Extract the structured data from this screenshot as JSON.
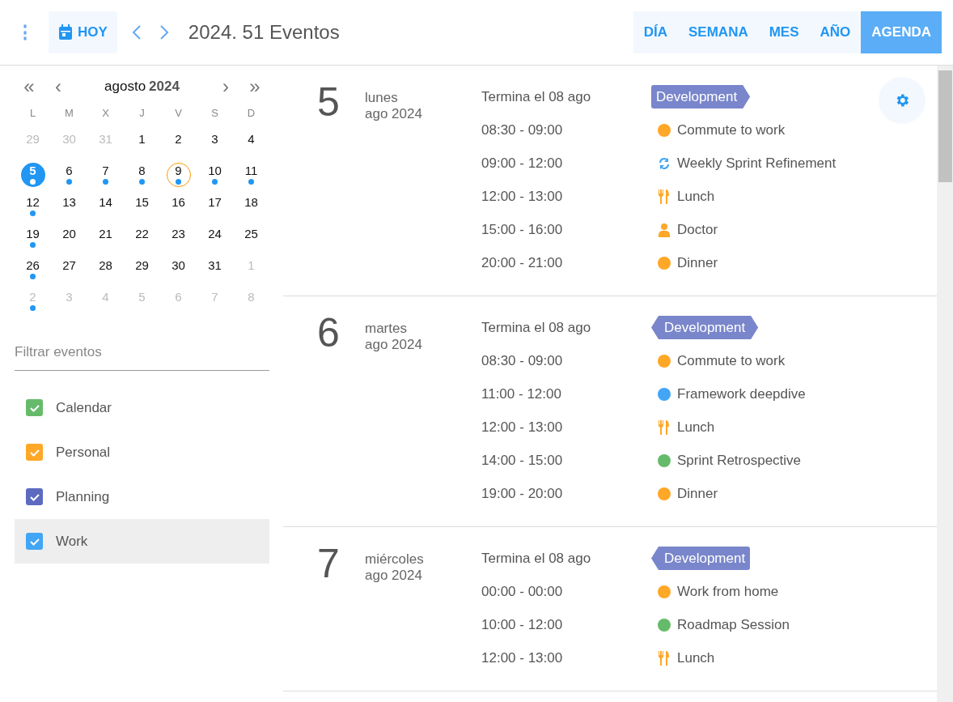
{
  "toolbar": {
    "menu_label": "⋮",
    "today_label": "HOY",
    "title": "2024. 51 Eventos",
    "views": [
      {
        "label": "DÍA",
        "selected": false
      },
      {
        "label": "SEMANA",
        "selected": false
      },
      {
        "label": "MES",
        "selected": false
      },
      {
        "label": "AÑO",
        "selected": false
      },
      {
        "label": "AGENDA",
        "selected": true
      }
    ]
  },
  "mini_calendar": {
    "prev_year": "«",
    "prev_month": "‹",
    "month": "agosto",
    "year": "2024",
    "next_month": "›",
    "next_year": "»",
    "weekdays": [
      "L",
      "M",
      "X",
      "J",
      "V",
      "S",
      "D"
    ],
    "days": [
      {
        "label": "29",
        "outside": true,
        "selected": false,
        "today": false,
        "has_events": false
      },
      {
        "label": "30",
        "outside": true,
        "selected": false,
        "today": false,
        "has_events": false
      },
      {
        "label": "31",
        "outside": true,
        "selected": false,
        "today": false,
        "has_events": false
      },
      {
        "label": "1",
        "outside": false,
        "selected": false,
        "today": false,
        "has_events": false
      },
      {
        "label": "2",
        "outside": false,
        "selected": false,
        "today": false,
        "has_events": false
      },
      {
        "label": "3",
        "outside": false,
        "selected": false,
        "today": false,
        "has_events": false
      },
      {
        "label": "4",
        "outside": false,
        "selected": false,
        "today": false,
        "has_events": false
      },
      {
        "label": "5",
        "outside": false,
        "selected": true,
        "today": false,
        "has_events": true
      },
      {
        "label": "6",
        "outside": false,
        "selected": false,
        "today": false,
        "has_events": true
      },
      {
        "label": "7",
        "outside": false,
        "selected": false,
        "today": false,
        "has_events": true
      },
      {
        "label": "8",
        "outside": false,
        "selected": false,
        "today": false,
        "has_events": true
      },
      {
        "label": "9",
        "outside": false,
        "selected": false,
        "today": true,
        "has_events": true
      },
      {
        "label": "10",
        "outside": false,
        "selected": false,
        "today": false,
        "has_events": true
      },
      {
        "label": "11",
        "outside": false,
        "selected": false,
        "today": false,
        "has_events": true
      },
      {
        "label": "12",
        "outside": false,
        "selected": false,
        "today": false,
        "has_events": true
      },
      {
        "label": "13",
        "outside": false,
        "selected": false,
        "today": false,
        "has_events": false
      },
      {
        "label": "14",
        "outside": false,
        "selected": false,
        "today": false,
        "has_events": false
      },
      {
        "label": "15",
        "outside": false,
        "selected": false,
        "today": false,
        "has_events": false
      },
      {
        "label": "16",
        "outside": false,
        "selected": false,
        "today": false,
        "has_events": false
      },
      {
        "label": "17",
        "outside": false,
        "selected": false,
        "today": false,
        "has_events": false
      },
      {
        "label": "18",
        "outside": false,
        "selected": false,
        "today": false,
        "has_events": false
      },
      {
        "label": "19",
        "outside": false,
        "selected": false,
        "today": false,
        "has_events": true
      },
      {
        "label": "20",
        "outside": false,
        "selected": false,
        "today": false,
        "has_events": false
      },
      {
        "label": "21",
        "outside": false,
        "selected": false,
        "today": false,
        "has_events": false
      },
      {
        "label": "22",
        "outside": false,
        "selected": false,
        "today": false,
        "has_events": false
      },
      {
        "label": "23",
        "outside": false,
        "selected": false,
        "today": false,
        "has_events": false
      },
      {
        "label": "24",
        "outside": false,
        "selected": false,
        "today": false,
        "has_events": false
      },
      {
        "label": "25",
        "outside": false,
        "selected": false,
        "today": false,
        "has_events": false
      },
      {
        "label": "26",
        "outside": false,
        "selected": false,
        "today": false,
        "has_events": true
      },
      {
        "label": "27",
        "outside": false,
        "selected": false,
        "today": false,
        "has_events": false
      },
      {
        "label": "28",
        "outside": false,
        "selected": false,
        "today": false,
        "has_events": false
      },
      {
        "label": "29",
        "outside": false,
        "selected": false,
        "today": false,
        "has_events": false
      },
      {
        "label": "30",
        "outside": false,
        "selected": false,
        "today": false,
        "has_events": false
      },
      {
        "label": "31",
        "outside": false,
        "selected": false,
        "today": false,
        "has_events": false
      },
      {
        "label": "1",
        "outside": true,
        "selected": false,
        "today": false,
        "has_events": false
      },
      {
        "label": "2",
        "outside": true,
        "selected": false,
        "today": false,
        "has_events": true
      },
      {
        "label": "3",
        "outside": true,
        "selected": false,
        "today": false,
        "has_events": false
      },
      {
        "label": "4",
        "outside": true,
        "selected": false,
        "today": false,
        "has_events": false
      },
      {
        "label": "5",
        "outside": true,
        "selected": false,
        "today": false,
        "has_events": false
      },
      {
        "label": "6",
        "outside": true,
        "selected": false,
        "today": false,
        "has_events": false
      },
      {
        "label": "7",
        "outside": true,
        "selected": false,
        "today": false,
        "has_events": false
      },
      {
        "label": "8",
        "outside": true,
        "selected": false,
        "today": false,
        "has_events": false
      }
    ]
  },
  "filter": {
    "placeholder": "Filtrar eventos",
    "calendars": [
      {
        "name": "Calendar",
        "color": "#66bb6a",
        "checked": true,
        "selected": false
      },
      {
        "name": "Personal",
        "color": "#ffa726",
        "checked": true,
        "selected": false
      },
      {
        "name": "Planning",
        "color": "#5c6bc0",
        "checked": true,
        "selected": false
      },
      {
        "name": "Work",
        "color": "#42a5f5",
        "checked": true,
        "selected": true
      }
    ]
  },
  "agenda": [
    {
      "day": "5",
      "weekday": "lunes",
      "month_year": "ago 2024",
      "events": [
        {
          "kind": "starts",
          "time": "Termina el 08 ago",
          "title": "Development",
          "color": "#7986cb"
        },
        {
          "kind": "dot",
          "time": "08:30 - 09:00",
          "title": "Commute to work",
          "color": "#ffa726"
        },
        {
          "kind": "recurring",
          "time": "09:00 - 12:00",
          "title": "Weekly Sprint Refinement",
          "color": "#42a5f5"
        },
        {
          "kind": "food",
          "time": "12:00 - 13:00",
          "title": "Lunch",
          "color": "#ffa726"
        },
        {
          "kind": "doctor",
          "time": "15:00 - 16:00",
          "title": "Doctor",
          "color": "#ffa726"
        },
        {
          "kind": "dot",
          "time": "20:00 - 21:00",
          "title": "Dinner",
          "color": "#ffa726"
        }
      ]
    },
    {
      "day": "6",
      "weekday": "martes",
      "month_year": "ago 2024",
      "events": [
        {
          "kind": "continues",
          "time": "Termina el 08 ago",
          "title": "Development",
          "color": "#7986cb"
        },
        {
          "kind": "dot",
          "time": "08:30 - 09:00",
          "title": "Commute to work",
          "color": "#ffa726"
        },
        {
          "kind": "dot",
          "time": "11:00 - 12:00",
          "title": "Framework deepdive",
          "color": "#42a5f5"
        },
        {
          "kind": "food",
          "time": "12:00 - 13:00",
          "title": "Lunch",
          "color": "#ffa726"
        },
        {
          "kind": "dot",
          "time": "14:00 - 15:00",
          "title": "Sprint Retrospective",
          "color": "#66bb6a"
        },
        {
          "kind": "dot",
          "time": "19:00 - 20:00",
          "title": "Dinner",
          "color": "#ffa726"
        }
      ]
    },
    {
      "day": "7",
      "weekday": "miércoles",
      "month_year": "ago 2024",
      "events": [
        {
          "kind": "ends",
          "time": "Termina el 08 ago",
          "title": "Development",
          "color": "#7986cb"
        },
        {
          "kind": "dot",
          "time": "00:00 - 00:00",
          "title": "Work from home",
          "color": "#ffa726"
        },
        {
          "kind": "dot",
          "time": "10:00 - 12:00",
          "title": "Roadmap Session",
          "color": "#66bb6a"
        },
        {
          "kind": "food",
          "time": "12:00 - 13:00",
          "title": "Lunch",
          "color": "#ffa726"
        }
      ]
    }
  ]
}
